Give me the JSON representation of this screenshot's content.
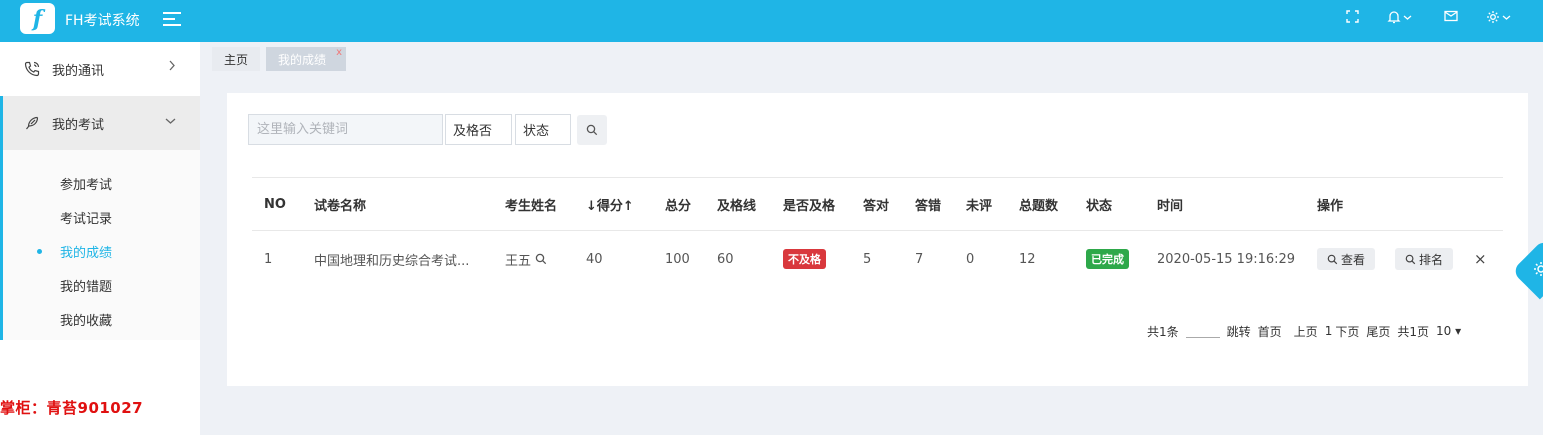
{
  "header": {
    "logo_letter": "f",
    "app_title": "FH考试系统",
    "icons": [
      "fullscreen-icon",
      "bell-icon",
      "mail-icon",
      "gear-icon"
    ]
  },
  "sidebar": {
    "items": [
      {
        "label": "我的通讯",
        "icon": "phone-icon",
        "expanded": false
      },
      {
        "label": "我的考试",
        "icon": "feather-icon",
        "expanded": true
      }
    ],
    "subitems": [
      {
        "label": "参加考试"
      },
      {
        "label": "考试记录"
      },
      {
        "label": "我的成绩"
      },
      {
        "label": "我的错题"
      },
      {
        "label": "我的收藏"
      }
    ],
    "watermark": "掌柜：青苔901027"
  },
  "tabs": [
    {
      "label": "主页"
    },
    {
      "label": "我的成绩",
      "close": "x"
    }
  ],
  "filters": {
    "search_placeholder": "这里输入关键词",
    "pass_select": "及格否",
    "status_select": "状态"
  },
  "table": {
    "headers": [
      "NO",
      "试卷名称",
      "考生姓名",
      "↓得分↑",
      "总分",
      "及格线",
      "是否及格",
      "答对",
      "答错",
      "未评",
      "总题数",
      "状态",
      "时间",
      "操作"
    ],
    "rows": [
      {
        "no": "1",
        "paper": "中国地理和历史综合考试...",
        "student": "王五",
        "score": "40",
        "total": "100",
        "pass_line": "60",
        "passed": "不及格",
        "correct": "5",
        "wrong": "7",
        "unrated": "0",
        "question_count": "12",
        "status": "已完成",
        "time": "2020-05-15 19:16:29",
        "view_label": "查看",
        "rank_label": "排名",
        "delete_label": "×"
      }
    ]
  },
  "pager": {
    "total": "共1条",
    "jump": "跳转",
    "first": "首页",
    "prev": "上页",
    "current": "1",
    "next": "下页",
    "last": "尾页",
    "pages": "共1页",
    "page_size": "10 ▾"
  },
  "colors": {
    "primary": "#1fb5e6",
    "fail": "#d9383d",
    "done": "#2ea84a"
  }
}
